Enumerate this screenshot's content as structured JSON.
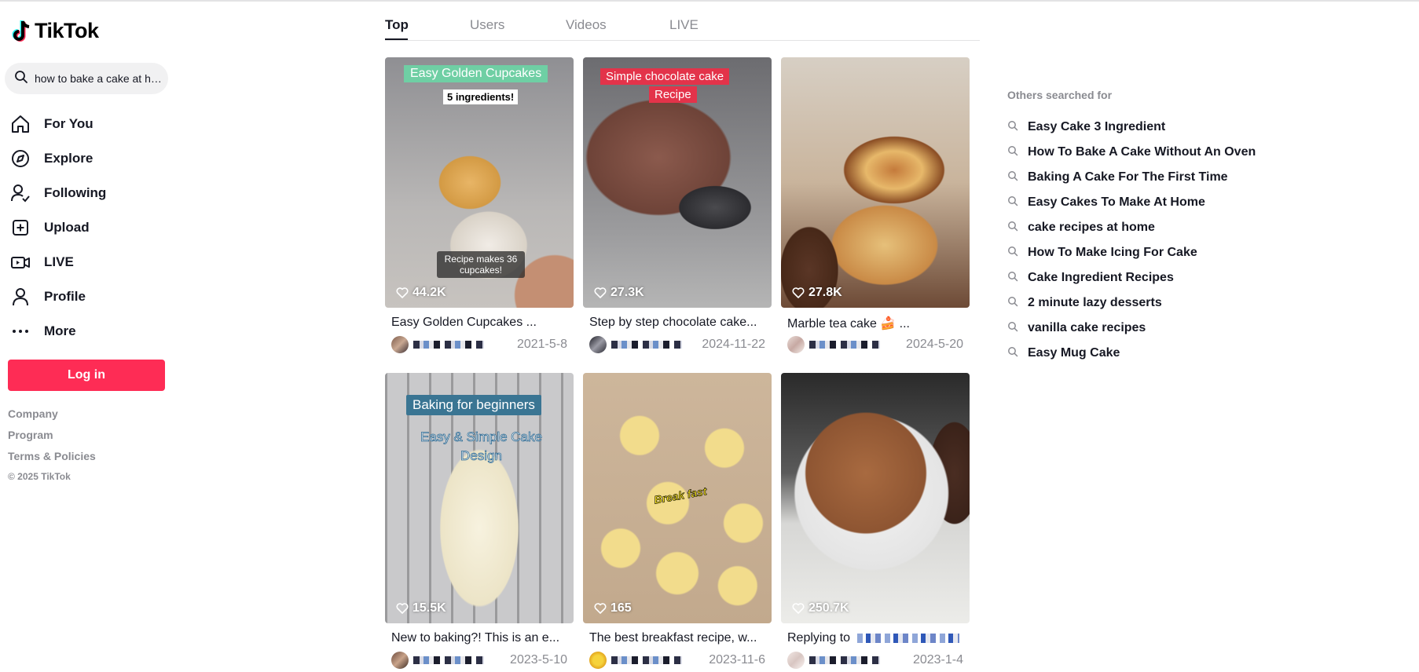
{
  "brand": {
    "name": "TikTok",
    "colors": {
      "accent": "#fe2c55",
      "cyan": "#25f4ee",
      "text": "#161823",
      "muted": "#8a8b91"
    }
  },
  "search": {
    "value": "how to bake a cake at home",
    "icon": "search-icon"
  },
  "nav": [
    {
      "label": "For You",
      "icon": "home-icon"
    },
    {
      "label": "Explore",
      "icon": "compass-icon"
    },
    {
      "label": "Following",
      "icon": "following-icon"
    },
    {
      "label": "Upload",
      "icon": "upload-icon"
    },
    {
      "label": "LIVE",
      "icon": "live-icon"
    },
    {
      "label": "Profile",
      "icon": "profile-icon"
    },
    {
      "label": "More",
      "icon": "more-icon"
    }
  ],
  "login_label": "Log in",
  "footer": {
    "links": [
      "Company",
      "Program",
      "Terms & Policies"
    ],
    "copyright": "© 2025 TikTok"
  },
  "tabs": [
    "Top",
    "Users",
    "Videos",
    "LIVE"
  ],
  "active_tab": "Top",
  "videos": [
    {
      "likes": "44.2K",
      "title": "Easy Golden Cupcakes ...",
      "date": "2021-5-8",
      "overlay": [
        "Easy Golden Cupcakes",
        "5 ingredients!",
        "Recipe makes 36 cupcakes!"
      ]
    },
    {
      "likes": "27.3K",
      "title": "Step by step chocolate cake...",
      "date": "2024-11-22",
      "overlay": [
        "Simple chocolate cake",
        "Recipe"
      ]
    },
    {
      "likes": "27.8K",
      "title": "Marble tea cake 🍰 ...",
      "date": "2024-5-20",
      "overlay": []
    },
    {
      "likes": "15.5K",
      "title": "New to baking?! This is an e...",
      "date": "2023-5-10",
      "overlay": [
        "Baking for beginners",
        "Easy & Simple Cake Design"
      ]
    },
    {
      "likes": "165",
      "title": "The best breakfast recipe, w...",
      "date": "2023-11-6",
      "overlay": [
        "Break fast"
      ]
    },
    {
      "likes": "250.7K",
      "title": "Replying to",
      "date": "2023-1-4",
      "overlay": []
    }
  ],
  "others": {
    "title": "Others searched for",
    "items": [
      "Easy Cake 3 Ingredient",
      "How To Bake A Cake Without An Oven",
      "Baking A Cake For The First Time",
      "Easy Cakes To Make At Home",
      "cake recipes at home",
      "How To Make Icing For Cake",
      "Cake Ingredient Recipes",
      "2 minute lazy desserts",
      "vanilla cake recipes",
      "Easy Mug Cake"
    ]
  }
}
